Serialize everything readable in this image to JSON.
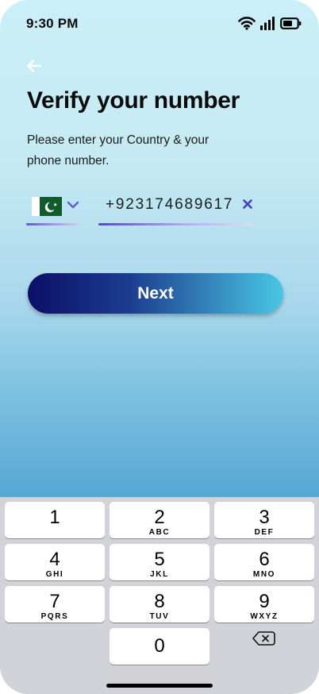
{
  "status_bar": {
    "time": "9:30 PM",
    "icons": [
      "wifi-icon",
      "cellular-signal-icon",
      "battery-icon"
    ]
  },
  "header": {
    "back_icon": "arrow-left-icon",
    "title": "Verify your number",
    "subtitle": "Please enter your Country & your phone number."
  },
  "form": {
    "country": {
      "flag": "pakistan-flag-icon",
      "dropdown_icon": "chevron-down-icon"
    },
    "phone": {
      "value": "+923174689617",
      "clear_icon": "close-icon"
    }
  },
  "actions": {
    "next_label": "Next"
  },
  "keypad": {
    "keys": [
      {
        "digit": "1",
        "letters": ""
      },
      {
        "digit": "2",
        "letters": "ABC"
      },
      {
        "digit": "3",
        "letters": "DEF"
      },
      {
        "digit": "4",
        "letters": "GHI"
      },
      {
        "digit": "5",
        "letters": "JKL"
      },
      {
        "digit": "6",
        "letters": "MNO"
      },
      {
        "digit": "7",
        "letters": "PQRS"
      },
      {
        "digit": "8",
        "letters": "TUV"
      },
      {
        "digit": "9",
        "letters": "WXYZ"
      },
      {
        "digit": "0",
        "letters": ""
      }
    ],
    "backspace_icon": "backspace-icon"
  },
  "colors": {
    "accent_purple": "#6a58d6",
    "button_start": "#0b0f66",
    "button_end": "#49c7e3",
    "flag_green": "#0f5b2c",
    "keypad_bg": "#d1d3d9"
  }
}
